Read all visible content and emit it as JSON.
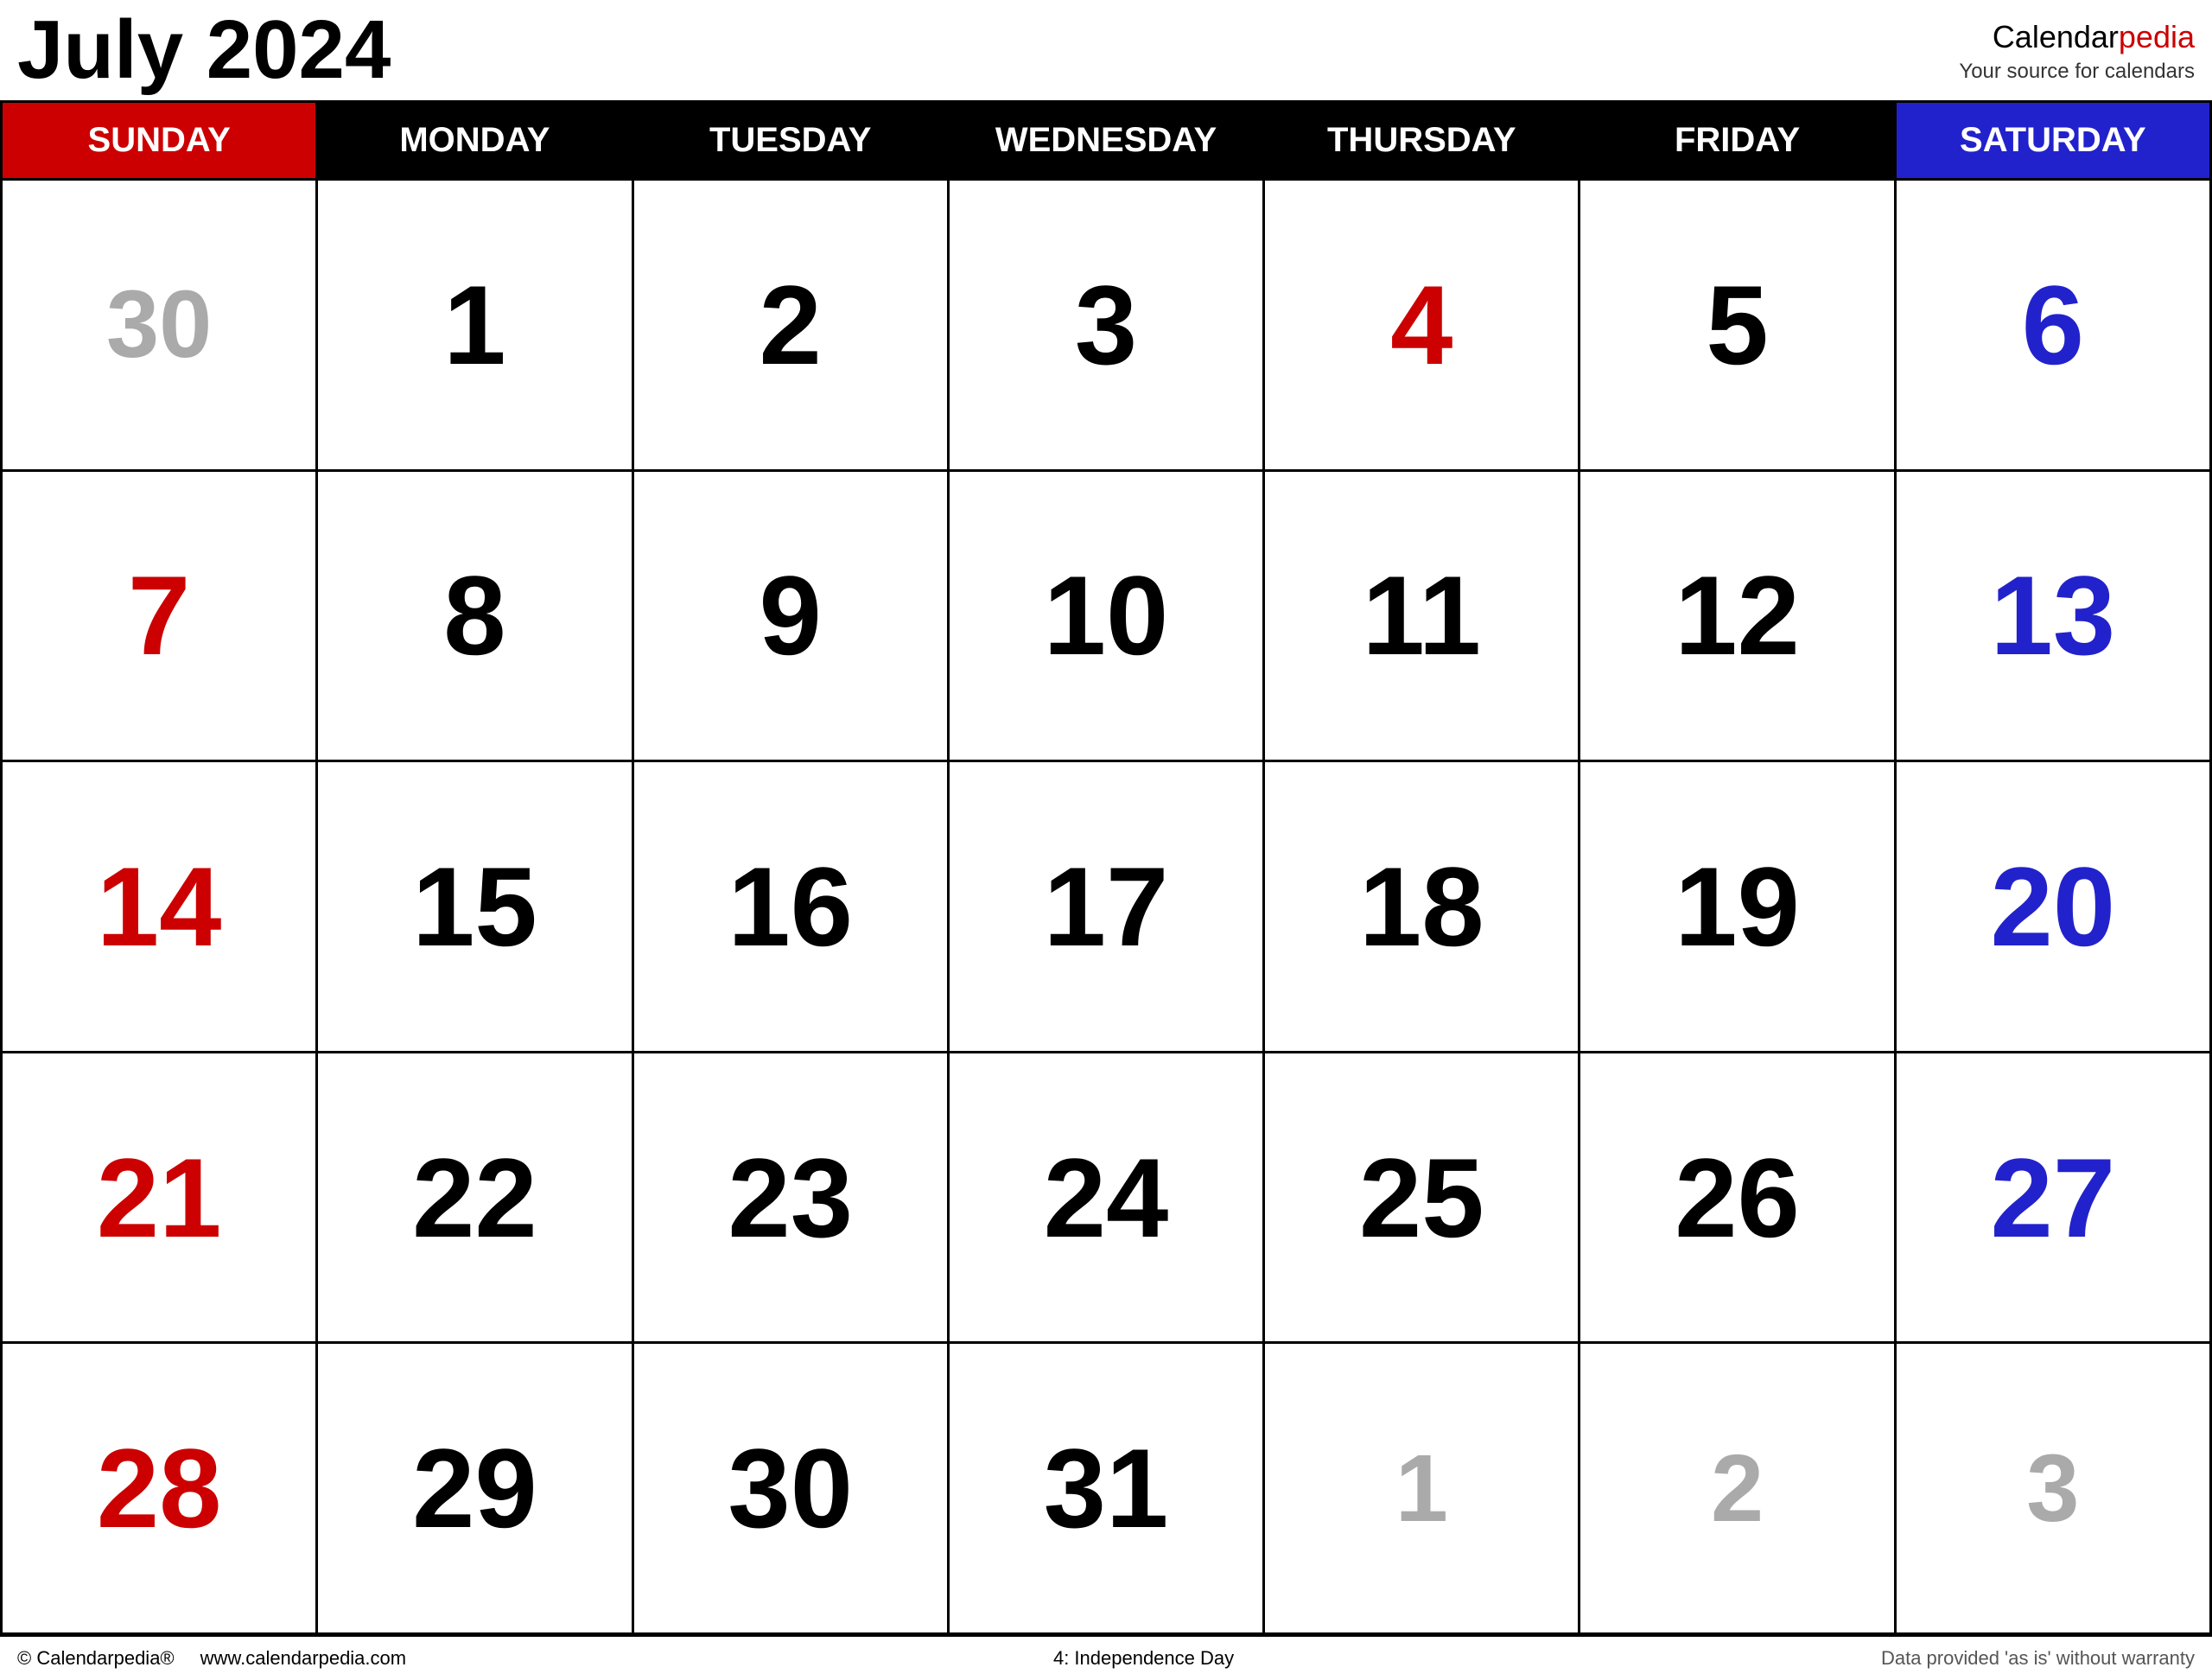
{
  "header": {
    "title": "July 2024",
    "brand_name": "Calendar",
    "brand_highlight": "pedia",
    "brand_tagline": "Your source for calendars"
  },
  "day_headers": [
    {
      "label": "Sunday",
      "type": "sunday"
    },
    {
      "label": "Monday",
      "type": "weekday"
    },
    {
      "label": "Tuesday",
      "type": "weekday"
    },
    {
      "label": "Wednesday",
      "type": "weekday"
    },
    {
      "label": "Thursday",
      "type": "weekday"
    },
    {
      "label": "Friday",
      "type": "weekday"
    },
    {
      "label": "Saturday",
      "type": "saturday"
    }
  ],
  "weeks": [
    [
      {
        "day": "30",
        "type": "overflow"
      },
      {
        "day": "1",
        "type": "weekday"
      },
      {
        "day": "2",
        "type": "weekday"
      },
      {
        "day": "3",
        "type": "weekday"
      },
      {
        "day": "4",
        "type": "holiday"
      },
      {
        "day": "5",
        "type": "weekday"
      },
      {
        "day": "6",
        "type": "saturday"
      }
    ],
    [
      {
        "day": "7",
        "type": "sunday"
      },
      {
        "day": "8",
        "type": "weekday"
      },
      {
        "day": "9",
        "type": "weekday"
      },
      {
        "day": "10",
        "type": "weekday"
      },
      {
        "day": "11",
        "type": "weekday"
      },
      {
        "day": "12",
        "type": "weekday"
      },
      {
        "day": "13",
        "type": "saturday"
      }
    ],
    [
      {
        "day": "14",
        "type": "sunday"
      },
      {
        "day": "15",
        "type": "weekday"
      },
      {
        "day": "16",
        "type": "weekday"
      },
      {
        "day": "17",
        "type": "weekday"
      },
      {
        "day": "18",
        "type": "weekday"
      },
      {
        "day": "19",
        "type": "weekday"
      },
      {
        "day": "20",
        "type": "saturday"
      }
    ],
    [
      {
        "day": "21",
        "type": "sunday"
      },
      {
        "day": "22",
        "type": "weekday"
      },
      {
        "day": "23",
        "type": "weekday"
      },
      {
        "day": "24",
        "type": "weekday"
      },
      {
        "day": "25",
        "type": "weekday"
      },
      {
        "day": "26",
        "type": "weekday"
      },
      {
        "day": "27",
        "type": "saturday"
      }
    ],
    [
      {
        "day": "28",
        "type": "sunday"
      },
      {
        "day": "29",
        "type": "weekday"
      },
      {
        "day": "30",
        "type": "weekday"
      },
      {
        "day": "31",
        "type": "weekday"
      },
      {
        "day": "1",
        "type": "overflow"
      },
      {
        "day": "2",
        "type": "overflow"
      },
      {
        "day": "3",
        "type": "overflow"
      }
    ]
  ],
  "footer": {
    "copyright": "© Calendarpedia®",
    "website": "www.calendarpedia.com",
    "holiday_note": "4: Independence Day",
    "disclaimer": "Data provided 'as is' without warranty"
  }
}
